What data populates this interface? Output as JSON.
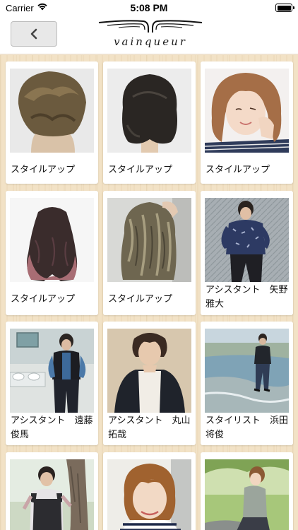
{
  "status_bar": {
    "carrier": "Carrier",
    "time": "5:08 PM"
  },
  "nav": {
    "back_icon": "chevron-left-icon",
    "logo_text": "vainqueur"
  },
  "gallery": [
    {
      "caption": "スタイルアップ",
      "photo": "short-hair-back-view"
    },
    {
      "caption": "スタイルアップ",
      "photo": "dark-bob-back-view"
    },
    {
      "caption": "スタイルアップ",
      "photo": "smiling-woman-wavy-hair"
    },
    {
      "caption": "スタイルアップ",
      "photo": "long-gradient-curls"
    },
    {
      "caption": "スタイルアップ",
      "photo": "ash-curls-back-view"
    },
    {
      "caption": "アシスタント　矢野　雅大",
      "photo": "man-in-patterned-shirt"
    },
    {
      "caption": "アシスタント　遠藤　俊馬",
      "photo": "man-in-vest-interior"
    },
    {
      "caption": "アシスタント　丸山　拓哉",
      "photo": "man-in-cardigan"
    },
    {
      "caption": "スタイリスト　浜田　将俊",
      "photo": "man-on-beach"
    },
    {
      "caption": "",
      "photo": "woman-in-overalls-tree"
    },
    {
      "caption": "",
      "photo": "woman-striped-shirt"
    },
    {
      "caption": "",
      "photo": "woman-sitting-park"
    }
  ]
}
